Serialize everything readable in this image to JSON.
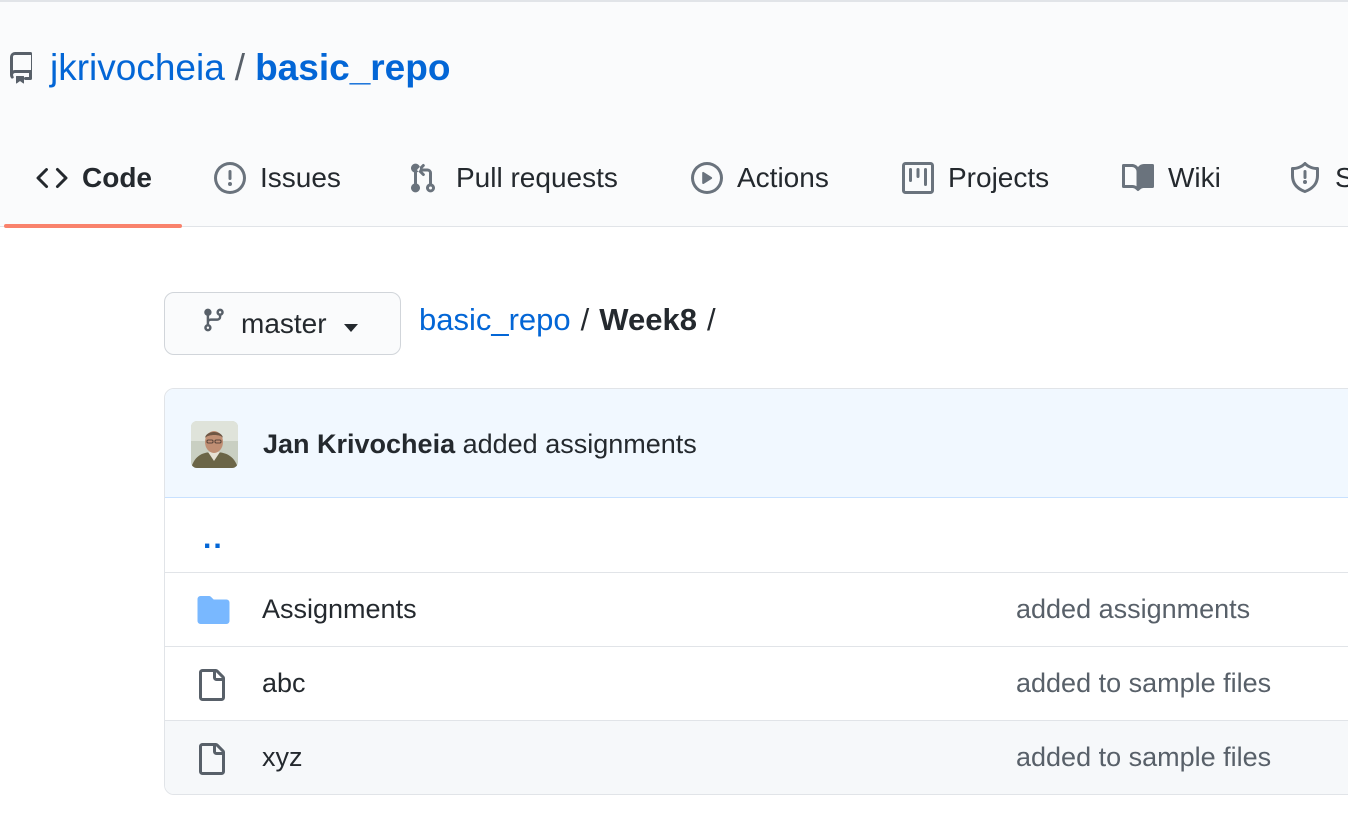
{
  "repo": {
    "owner": "jkrivocheia",
    "separator": "/",
    "name": "basic_repo"
  },
  "tabs": [
    {
      "label": "Code",
      "icon": "code-icon",
      "selected": true
    },
    {
      "label": "Issues",
      "icon": "issue-icon"
    },
    {
      "label": "Pull requests",
      "icon": "pull-request-icon"
    },
    {
      "label": "Actions",
      "icon": "play-icon"
    },
    {
      "label": "Projects",
      "icon": "project-icon"
    },
    {
      "label": "Wiki",
      "icon": "book-icon"
    },
    {
      "label": "S",
      "icon": "shield-icon"
    }
  ],
  "branch": {
    "label": "master",
    "icon": "git-branch-icon"
  },
  "breadcrumb": {
    "root": "basic_repo",
    "sep": "/",
    "current": "Week8",
    "trailing": "/"
  },
  "commit": {
    "author": "Jan Krivocheia",
    "message": "added assignments"
  },
  "files": {
    "updir": "..",
    "rows": [
      {
        "name": "Assignments",
        "type": "folder",
        "icon": "folder-icon",
        "message": "added assignments"
      },
      {
        "name": "abc",
        "type": "file",
        "icon": "file-icon",
        "message": "added to sample files"
      },
      {
        "name": "xyz",
        "type": "file",
        "icon": "file-icon",
        "message": "added to sample files"
      }
    ]
  },
  "colors": {
    "link": "#0366d6",
    "tab_underline": "#f9826c",
    "folder": "#79b8ff",
    "commit_bg": "#f1f8ff"
  }
}
